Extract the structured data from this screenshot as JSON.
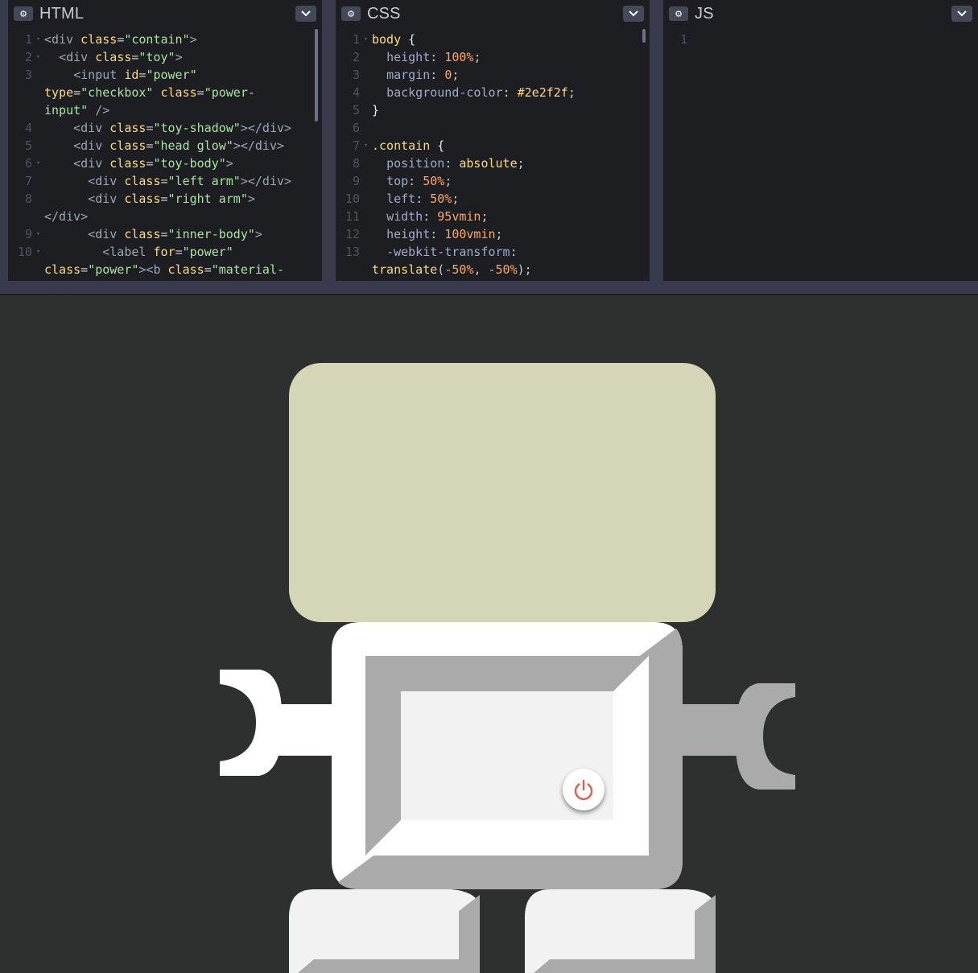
{
  "panes": {
    "html": {
      "title": "HTML",
      "lines": [
        {
          "n": "1",
          "fold": true,
          "html": "<span class=\"t\">&lt;div</span> <span class=\"a\">class</span>=<span class=\"s\">\"contain\"</span><span class=\"t\">&gt;</span>"
        },
        {
          "n": "2",
          "fold": true,
          "html": "  <span class=\"t\">&lt;div</span> <span class=\"a\">class</span>=<span class=\"s\">\"toy\"</span><span class=\"t\">&gt;</span>"
        },
        {
          "n": "3",
          "fold": false,
          "html": "    <span class=\"t\">&lt;input</span> <span class=\"a\">id</span>=<span class=\"s\">\"power\"</span>"
        },
        {
          "n": "",
          "fold": false,
          "html": "<span class=\"a\">type</span>=<span class=\"s\">\"checkbox\"</span> <span class=\"a\">class</span>=<span class=\"s\">\"power-</span>",
          "wrap": true
        },
        {
          "n": "",
          "fold": false,
          "html": "<span class=\"s\">input\"</span> <span class=\"t\">/&gt;</span>",
          "wrap": true
        },
        {
          "n": "4",
          "fold": false,
          "html": "    <span class=\"t\">&lt;div</span> <span class=\"a\">class</span>=<span class=\"s\">\"toy-shadow\"</span><span class=\"t\">&gt;&lt;/div&gt;</span>"
        },
        {
          "n": "5",
          "fold": false,
          "html": "    <span class=\"t\">&lt;div</span> <span class=\"a\">class</span>=<span class=\"s\">\"head glow\"</span><span class=\"t\">&gt;&lt;/div&gt;</span>"
        },
        {
          "n": "6",
          "fold": true,
          "html": "    <span class=\"t\">&lt;div</span> <span class=\"a\">class</span>=<span class=\"s\">\"toy-body\"</span><span class=\"t\">&gt;</span>"
        },
        {
          "n": "7",
          "fold": false,
          "html": "      <span class=\"t\">&lt;div</span> <span class=\"a\">class</span>=<span class=\"s\">\"left arm\"</span><span class=\"t\">&gt;&lt;/div&gt;</span>"
        },
        {
          "n": "8",
          "fold": false,
          "html": "      <span class=\"t\">&lt;div</span> <span class=\"a\">class</span>=<span class=\"s\">\"right arm\"</span><span class=\"t\">&gt;</span>"
        },
        {
          "n": "",
          "fold": false,
          "html": "<span class=\"t\">&lt;/div&gt;</span>",
          "wrap": true
        },
        {
          "n": "9",
          "fold": true,
          "html": "      <span class=\"t\">&lt;div</span> <span class=\"a\">class</span>=<span class=\"s\">\"inner-body\"</span><span class=\"t\">&gt;</span>"
        },
        {
          "n": "10",
          "fold": true,
          "html": "        <span class=\"t\">&lt;label</span> <span class=\"a\">for</span>=<span class=\"s\">\"power\"</span>"
        },
        {
          "n": "",
          "fold": false,
          "html": "<span class=\"a\">class</span>=<span class=\"s\">\"power\"</span><span class=\"t\">&gt;&lt;b</span> <span class=\"a\">class</span>=<span class=\"s\">\"material-</span>",
          "wrap": true
        }
      ]
    },
    "css": {
      "title": "CSS",
      "lines": [
        {
          "n": "1",
          "fold": true,
          "html": "<span class=\"sel\">body</span> <span class=\"w\">{</span>"
        },
        {
          "n": "2",
          "fold": false,
          "html": "  <span class=\"p\">height</span>: <span class=\"n\">100%</span>;"
        },
        {
          "n": "3",
          "fold": false,
          "html": "  <span class=\"p\">margin</span>: <span class=\"n\">0</span>;"
        },
        {
          "n": "4",
          "fold": false,
          "html": "  <span class=\"p\">background-color</span>: <span class=\"sel\">#2e2f2f</span>;"
        },
        {
          "n": "5",
          "fold": false,
          "html": "<span class=\"w\">}</span>"
        },
        {
          "n": "6",
          "fold": false,
          "html": ""
        },
        {
          "n": "7",
          "fold": true,
          "html": "<span class=\"sel\">.contain</span> <span class=\"w\">{</span>"
        },
        {
          "n": "8",
          "fold": false,
          "html": "  <span class=\"p\">position</span>: <span class=\"sel\">absolute</span>;"
        },
        {
          "n": "9",
          "fold": false,
          "html": "  <span class=\"p\">top</span>: <span class=\"n\">50%</span>;"
        },
        {
          "n": "10",
          "fold": false,
          "html": "  <span class=\"p\">left</span>: <span class=\"n\">50%</span>;"
        },
        {
          "n": "11",
          "fold": false,
          "html": "  <span class=\"p\">width</span>: <span class=\"n\">95vmin</span>;"
        },
        {
          "n": "12",
          "fold": false,
          "html": "  <span class=\"p\">height</span>: <span class=\"n\">100vmin</span>;"
        },
        {
          "n": "13",
          "fold": false,
          "html": "  <span class=\"p\">-webkit-transform</span>:"
        },
        {
          "n": "",
          "fold": false,
          "html": "<span class=\"sel\">translate</span>(<span class=\"n\">-50%</span>, <span class=\"n\">-50%</span>);",
          "wrap": true
        }
      ]
    },
    "js": {
      "title": "JS",
      "lines": [
        {
          "n": "1",
          "fold": false,
          "html": ""
        }
      ]
    }
  },
  "robot": {
    "power_icon": "power-icon",
    "colors": {
      "head": "#d5d5b8",
      "body_white": "#ffffff",
      "body_grey": "#aaaaaa",
      "screen": "#f2f2f2",
      "power_red": "#e8594a",
      "background": "#2e2f2f"
    }
  }
}
